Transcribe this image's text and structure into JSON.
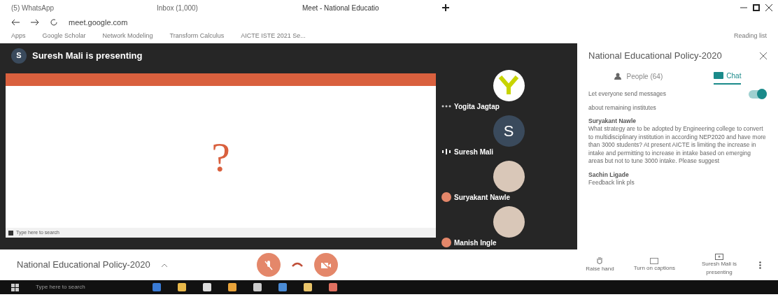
{
  "browser": {
    "tabs": [
      {
        "title": "(5) WhatsApp",
        "selected": false
      },
      {
        "title": "Inbox (1,000)",
        "selected": false
      },
      {
        "title": "Meet - National Educatio",
        "selected": true
      }
    ],
    "url": "meet.google.com",
    "bookmarks": [
      "Apps",
      "Google Scholar",
      "Network Modeling",
      "Transform Calculus",
      "AICTE ISTE 2021 Se..."
    ],
    "reading_list": "Reading list"
  },
  "stage": {
    "presenter_banner": {
      "letter": "S",
      "text": "Suresh Mali is presenting"
    },
    "shared_screen": {
      "symbol": "?",
      "search": "Type here to search"
    },
    "participants": [
      {
        "name": "Yogita Jagtap",
        "avatar": {
          "kind": "logo"
        },
        "indicator": {
          "kind": "idle"
        }
      },
      {
        "name": "Suresh Mali",
        "avatar": {
          "kind": "letter",
          "letter": "S"
        },
        "indicator": {
          "kind": "speaking"
        }
      },
      {
        "name": "Suryakant Nawle",
        "avatar": {
          "kind": "photo"
        },
        "indicator": {
          "kind": "muted"
        }
      },
      {
        "name": "Manish Ingle",
        "avatar": {
          "kind": "photo"
        },
        "indicator": {
          "kind": "muted"
        }
      }
    ]
  },
  "panel": {
    "title": "National Educational Policy-2020",
    "tabs": [
      {
        "label": "People (64)",
        "selected": false
      },
      {
        "label": "Chat",
        "selected": true
      }
    ],
    "toggle": {
      "label": "Let everyone send messages",
      "on": true
    },
    "messages": [
      {
        "text": "about remaining institutes"
      },
      {
        "sender": "Suryakant Nawle",
        "text": "What strategy are to be adopted by Engineering college to convert to multidisciplinary institution in according NEP2020 and have more than 3000 students? At present AICTE is limiting the increase in intake and permitting to increase in intake based on emerging areas but not to tune 3000 intake. Please suggest"
      },
      {
        "sender": "Sachin Ligade",
        "text": "Feedback link pls"
      }
    ]
  },
  "controls": {
    "meeting_title": "National Educational Policy-2020",
    "mic_on": false,
    "camera_on": false,
    "actions": [
      {
        "kind": "hand",
        "label": "Raise hand"
      },
      {
        "kind": "captions",
        "label": "Turn on captions"
      },
      {
        "kind": "present",
        "label": "Suresh Mali is presenting"
      }
    ]
  },
  "taskbar": {
    "search": "Type here to search"
  }
}
